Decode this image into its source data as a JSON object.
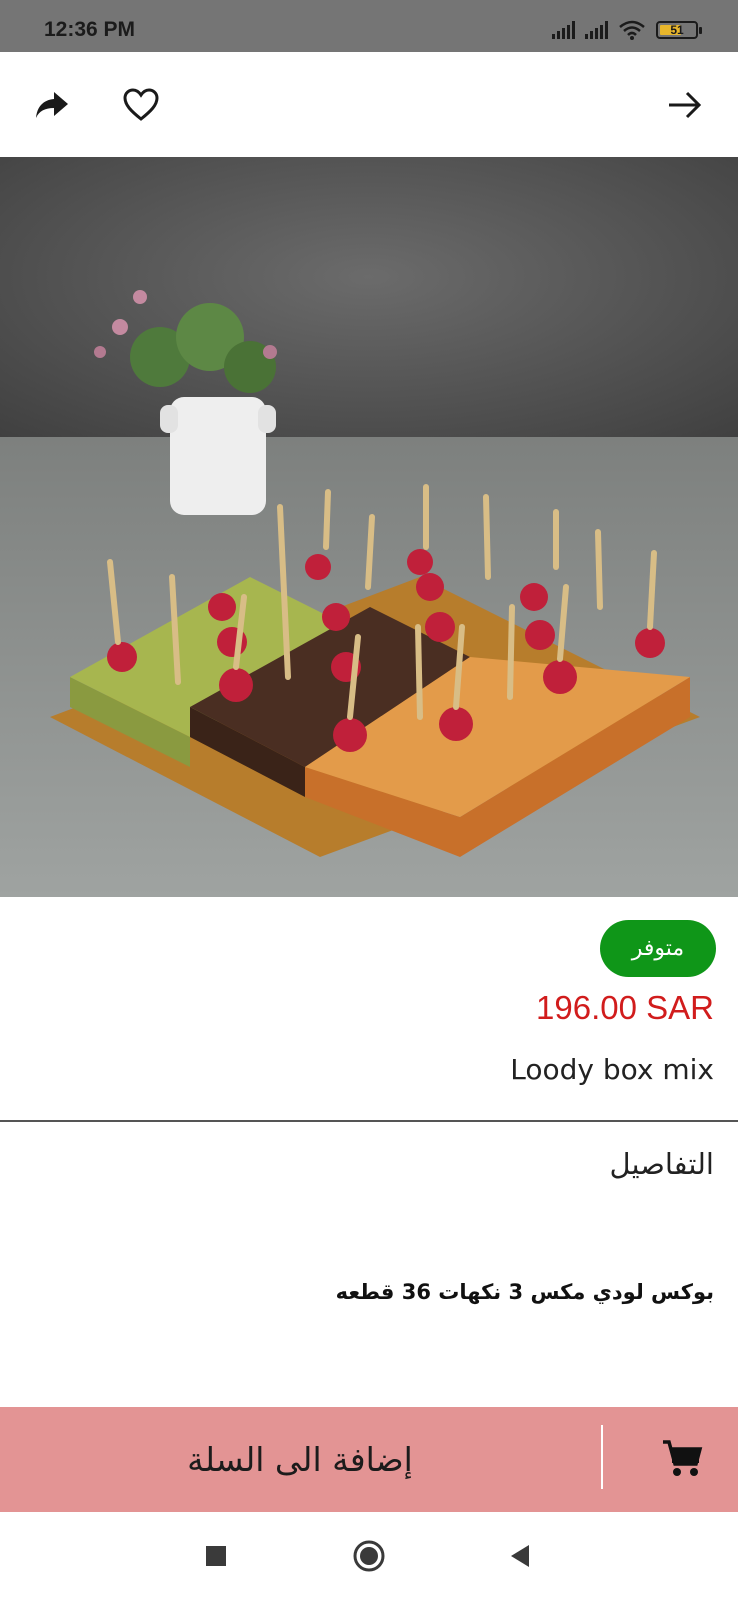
{
  "status_bar": {
    "time": "12:36 PM",
    "battery": "51"
  },
  "app_bar": {
    "share_icon": "share-icon",
    "favorite_icon": "heart-outline-icon",
    "back_icon": "arrow-right-icon"
  },
  "product": {
    "availability": "متوفر",
    "price": "196.00 SAR",
    "name": "Loody box mix",
    "details_title": "التفاصيل",
    "details_text": "بوكس لودي مكس 3 نكهات 36 قطعه"
  },
  "cart": {
    "label": "إضافة الى السلة",
    "icon": "cart-icon"
  },
  "colors": {
    "cart_bar": "#e39494",
    "badge": "#0f9618",
    "price": "#d11c1c"
  },
  "nav": {
    "recents_icon": "square-icon",
    "home_icon": "circle-icon",
    "back_icon": "triangle-back-icon"
  }
}
